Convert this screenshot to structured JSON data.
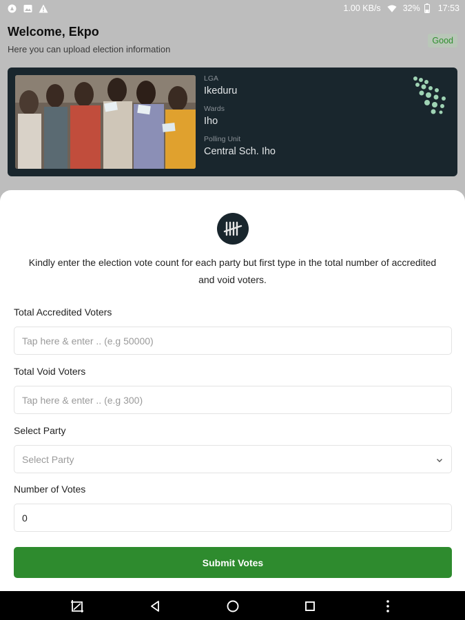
{
  "status_bar": {
    "net_speed": "1.00 KB/s",
    "battery": "32%",
    "time": "17:53",
    "icons": [
      "app-icon",
      "image-icon",
      "warning-icon",
      "wifi-icon",
      "battery-icon"
    ]
  },
  "header": {
    "welcome": "Welcome, Ekpo",
    "subtitle": "Here you can upload election information",
    "badge": "Good"
  },
  "card": {
    "lga_label": "LGA",
    "lga_value": "Ikeduru",
    "wards_label": "Wards",
    "wards_value": "Iho",
    "pu_label": "Polling Unit",
    "pu_value": "Central Sch. Iho"
  },
  "sheet": {
    "icon": "tally-icon",
    "instructions": "Kindly enter the election vote count for each party but first type in the total number of accredited and void voters.",
    "accredited": {
      "label": "Total Accredited Voters",
      "placeholder": "Tap here & enter .. (e.g 50000)"
    },
    "void": {
      "label": "Total Void Voters",
      "placeholder": "Tap here & enter .. (e.g 300)"
    },
    "party": {
      "label": "Select Party",
      "placeholder": "Select Party"
    },
    "votes": {
      "label": "Number of Votes",
      "value": "0"
    },
    "submit": "Submit Votes"
  },
  "colors": {
    "accent_green": "#2e8b2e",
    "card_dark": "#19262d",
    "dots_green": "#9fd3b4"
  },
  "nav": [
    "screenshot-icon",
    "back-icon",
    "home-icon",
    "recents-icon",
    "more-icon"
  ]
}
